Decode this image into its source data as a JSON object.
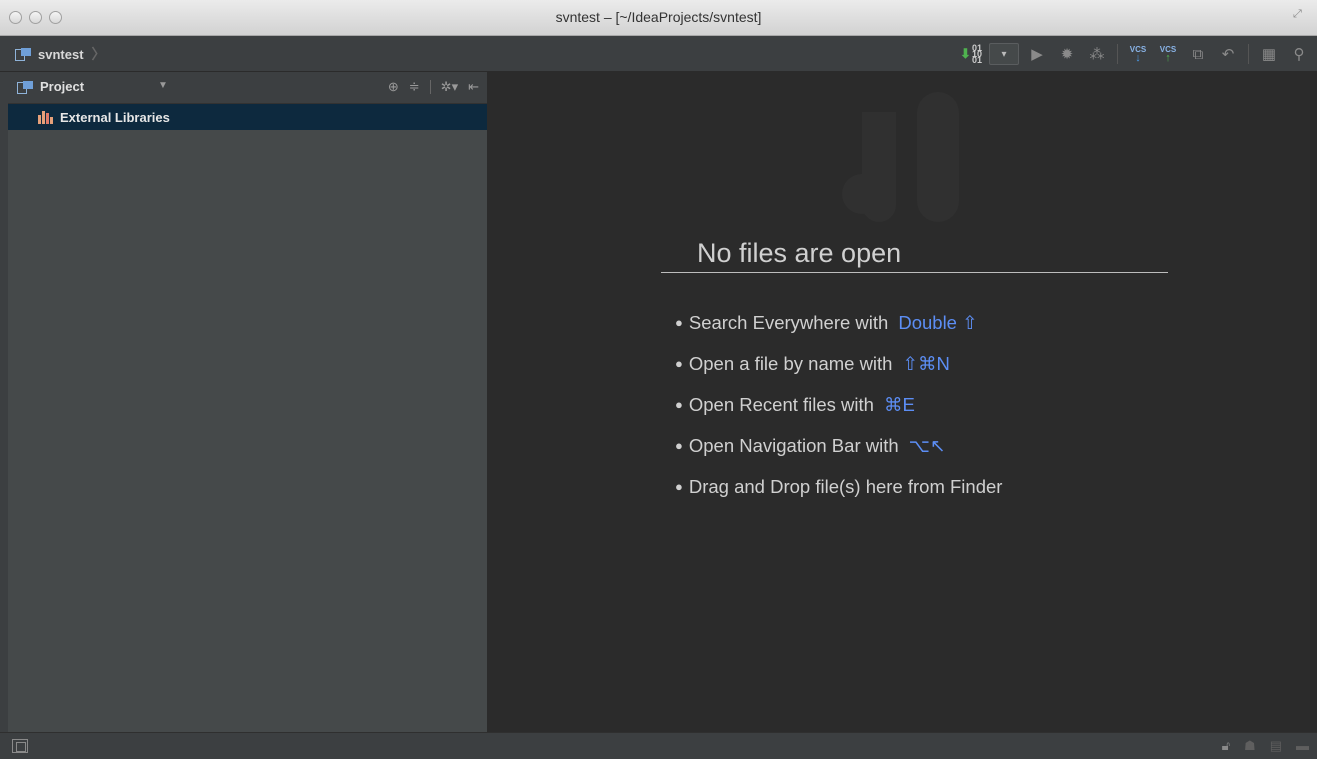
{
  "window": {
    "title": "svntest – [~/IdeaProjects/svntest]"
  },
  "navbar": {
    "breadcrumb": "svntest",
    "run_config_label": "▾"
  },
  "toolbar": {
    "icons": [
      "make-project-icon",
      "run-config-dropdown",
      "run-icon",
      "debug-icon",
      "coverage-icon",
      "vcs-update-icon",
      "vcs-commit-icon",
      "vcs-compare-icon",
      "undo-icon",
      "project-structure-icon",
      "search-icon"
    ],
    "vcs_label": "VCS"
  },
  "project_panel": {
    "title": "Project",
    "tree": [
      {
        "label": "External Libraries",
        "selected": true
      }
    ]
  },
  "editor": {
    "empty_title": "No files are open",
    "hints": [
      {
        "text": "Search Everywhere with",
        "shortcut": "Double ⇧"
      },
      {
        "text": "Open a file by name with",
        "shortcut": "⇧⌘N"
      },
      {
        "text": "Open Recent files with",
        "shortcut": "⌘E"
      },
      {
        "text": "Open Navigation Bar with",
        "shortcut": "⌥↖"
      },
      {
        "text": "Drag and Drop file(s) here from Finder",
        "shortcut": ""
      }
    ]
  },
  "colors": {
    "accent_shortcut": "#5c8ef5",
    "selection": "#0d293e",
    "editor_bg": "#2b2b2b",
    "panel_bg": "#45494a"
  }
}
